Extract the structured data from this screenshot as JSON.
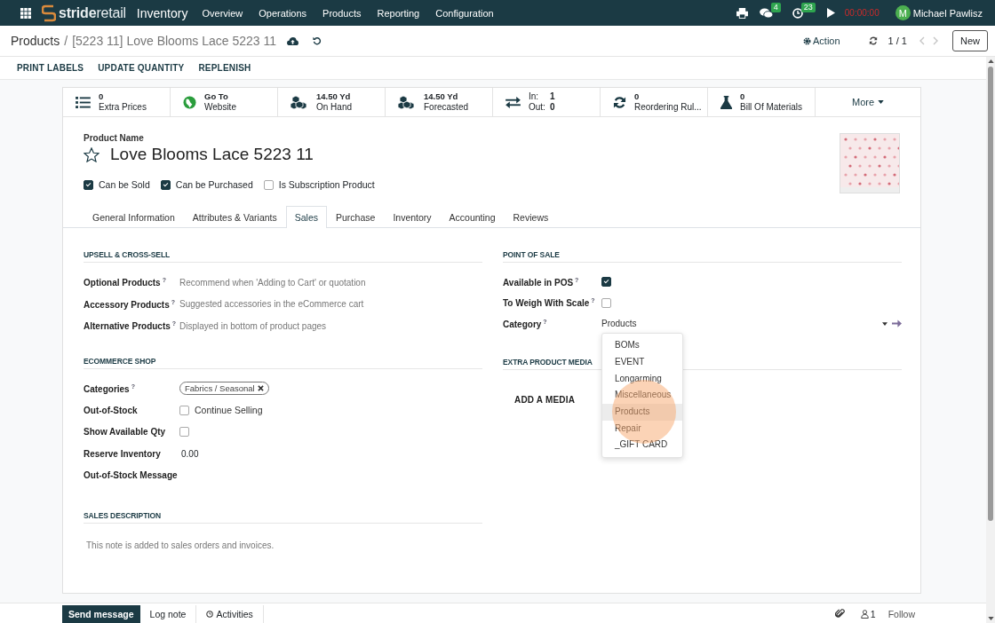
{
  "navbar": {
    "brand_a": "stride",
    "brand_b": "retail",
    "app_name": "Inventory",
    "menu": [
      "Overview",
      "Operations",
      "Products",
      "Reporting",
      "Configuration"
    ],
    "messages_count": "4",
    "activities_count": "23",
    "timer": "00:00:00",
    "user": {
      "initial": "M",
      "name": "Michael Pawlisz"
    }
  },
  "breadcrumb": {
    "parent": "Products",
    "separator": "/",
    "current": "[5223 11] Love Blooms Lace 5223 11"
  },
  "control_panel": {
    "action": "Action",
    "pager": "1 / 1",
    "new_button": "New"
  },
  "action_buttons": [
    "PRINT LABELS",
    "UPDATE QUANTITY",
    "REPLENISH"
  ],
  "stat_buttons": [
    {
      "kind": "stat",
      "value": "0",
      "label": "Extra Prices"
    },
    {
      "kind": "stat",
      "value": "Go To",
      "label": "Website"
    },
    {
      "kind": "stat",
      "value": "14.50 Yd",
      "label": "On Hand"
    },
    {
      "kind": "stat",
      "value": "14.50 Yd",
      "label": "Forecasted"
    },
    {
      "kind": "inout",
      "in_label": "In:",
      "in_value": "1",
      "out_label": "Out:",
      "out_value": "0"
    },
    {
      "kind": "stat",
      "value": "0",
      "label": "Reordering Rul..."
    },
    {
      "kind": "stat",
      "value": "0",
      "label": "Bill Of Materials"
    },
    {
      "kind": "more",
      "label": "More"
    }
  ],
  "product": {
    "name_label": "Product Name",
    "name": "Love Blooms Lace 5223 11",
    "starred": false,
    "options": [
      {
        "label": "Can be Sold",
        "checked": true
      },
      {
        "label": "Can be Purchased",
        "checked": true
      },
      {
        "label": "Is Subscription Product",
        "checked": false
      }
    ]
  },
  "tabs": [
    {
      "label": "General Information",
      "selected": false
    },
    {
      "label": "Attributes & Variants",
      "selected": false
    },
    {
      "label": "Sales",
      "selected": true
    },
    {
      "label": "Purchase",
      "selected": false
    },
    {
      "label": "Inventory",
      "selected": false
    },
    {
      "label": "Accounting",
      "selected": false
    },
    {
      "label": "Reviews",
      "selected": false
    }
  ],
  "upsell": {
    "title": "UPSELL & CROSS-SELL",
    "fields": [
      {
        "label": "Optional Products",
        "help": "?",
        "placeholder": "Recommend when 'Adding to Cart' or quotation"
      },
      {
        "label": "Accessory Products",
        "help": "?",
        "placeholder": "Suggested accessories in the eCommerce cart"
      },
      {
        "label": "Alternative Products",
        "help": "?",
        "placeholder": "Displayed in bottom of product pages"
      }
    ]
  },
  "ecommerce": {
    "title": "ECOMMERCE SHOP",
    "fields": [
      {
        "kind": "tags",
        "label": "Categories",
        "help": "?",
        "tags": [
          "Fabrics / Seasonal"
        ]
      },
      {
        "kind": "checkbox",
        "label": "Out-of-Stock",
        "checked": false,
        "text": "Continue Selling"
      },
      {
        "kind": "checkbox",
        "label": "Show Available Qty",
        "checked": false
      },
      {
        "kind": "number",
        "label": "Reserve Inventory",
        "value": "0.00"
      },
      {
        "kind": "text",
        "label": "Out-of-Stock Message"
      }
    ]
  },
  "point_of_sale": {
    "title": "POINT OF SALE",
    "fields": [
      {
        "kind": "checkbox",
        "label": "Available in POS",
        "help": "?",
        "checked": true
      },
      {
        "kind": "checkbox",
        "label": "To Weigh With Scale",
        "help": "?",
        "checked": false
      },
      {
        "kind": "select",
        "label": "Category",
        "help": "?",
        "value": "Products",
        "expanded": true,
        "options": [
          {
            "label": "BOMs",
            "selected": false
          },
          {
            "label": "EVENT",
            "selected": false
          },
          {
            "label": "Longarming",
            "selected": false
          },
          {
            "label": "Miscellaneous",
            "selected": false
          },
          {
            "label": "Products",
            "selected": true
          },
          {
            "label": "Repair",
            "selected": false
          },
          {
            "label": "_GIFT CARD",
            "selected": false
          }
        ]
      }
    ]
  },
  "extra_media": {
    "title": "EXTRA PRODUCT MEDIA",
    "add_button": "ADD A MEDIA"
  },
  "sales_description": {
    "title": "SALES DESCRIPTION",
    "placeholder": "This note is added to sales orders and invoices."
  },
  "chatter": {
    "send_message": "Send message",
    "log_note": "Log note",
    "activities": "Activities",
    "followers": "1",
    "follow": "Follow"
  },
  "click_marker": true
}
